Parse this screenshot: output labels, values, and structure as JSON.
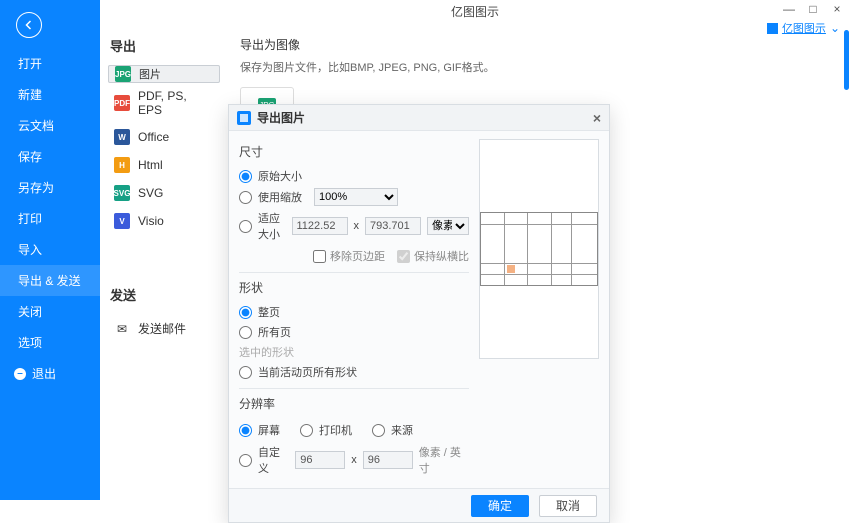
{
  "app_title": "亿图图示",
  "help_link": "亿图图示",
  "window": {
    "min": "—",
    "max": "□",
    "close": "×"
  },
  "sidebar": {
    "items": [
      "打开",
      "新建",
      "云文档",
      "保存",
      "另存为",
      "打印",
      "导入",
      "导出 & 发送",
      "关闭",
      "选项"
    ],
    "selected_index": 7,
    "logout": "退出"
  },
  "panel": {
    "export_head": "导出",
    "send_head": "发送",
    "formats": [
      {
        "label": "图片",
        "color": "#1aa374",
        "abbr": "JPG",
        "selected": true
      },
      {
        "label": "PDF, PS, EPS",
        "color": "#e74c3c",
        "abbr": "PDF"
      },
      {
        "label": "Office",
        "color": "#2b579a",
        "abbr": "W"
      },
      {
        "label": "Html",
        "color": "#f39c12",
        "abbr": "H"
      },
      {
        "label": "SVG",
        "color": "#16a085",
        "abbr": "SVG"
      },
      {
        "label": "Visio",
        "color": "#3b5bdb",
        "abbr": "V"
      }
    ],
    "send_item": "发送邮件"
  },
  "right": {
    "head": "导出为图像",
    "desc": "保存为图片文件，比如BMP, JPEG, PNG, GIF格式。"
  },
  "modal": {
    "title": "导出图片",
    "size": {
      "head": "尺寸",
      "orig": "原始大小",
      "zoom": "使用缩放",
      "zoom_val": "100%",
      "fit": "适应大小",
      "w": "1122.52",
      "h": "793.701",
      "unit": "像素",
      "trim": "移除页边距",
      "ratio": "保持纵横比"
    },
    "shape": {
      "head": "形状",
      "full": "整页",
      "all": "所有页",
      "sel": "选中的形状",
      "act": "当前活动页所有形状"
    },
    "res": {
      "head": "分辨率",
      "screen": "屏幕",
      "printer": "打印机",
      "source": "来源",
      "custom": "自定义",
      "v1": "96",
      "v2": "96",
      "unit": "像素 / 英寸"
    },
    "ok": "确定",
    "cancel": "取消"
  }
}
